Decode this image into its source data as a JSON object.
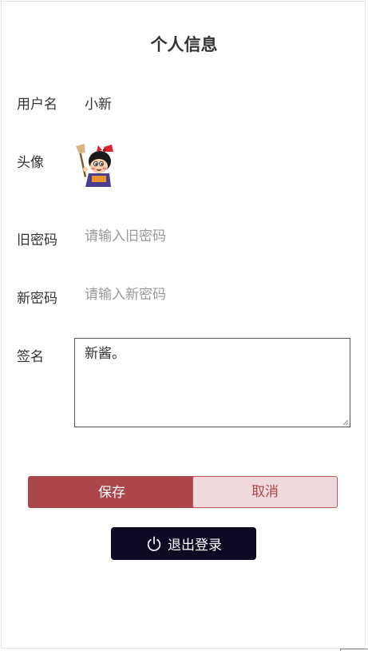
{
  "page": {
    "title": "个人信息"
  },
  "form": {
    "username": {
      "label": "用户名",
      "value": "小新"
    },
    "avatar": {
      "label": "头像",
      "icon": "cartoon-avatar-icon"
    },
    "old_password": {
      "label": "旧密码",
      "placeholder": "请输入旧密码",
      "value": ""
    },
    "new_password": {
      "label": "新密码",
      "placeholder": "请输入新密码",
      "value": ""
    },
    "signature": {
      "label": "签名",
      "value": "新酱。"
    }
  },
  "actions": {
    "save_label": "保存",
    "cancel_label": "取消",
    "logout_label": "退出登录",
    "logout_icon": "power-icon"
  },
  "colors": {
    "primary": "#ab474b",
    "cancel_bg": "#f0d9dc",
    "logout_bg": "#0e0a24"
  }
}
